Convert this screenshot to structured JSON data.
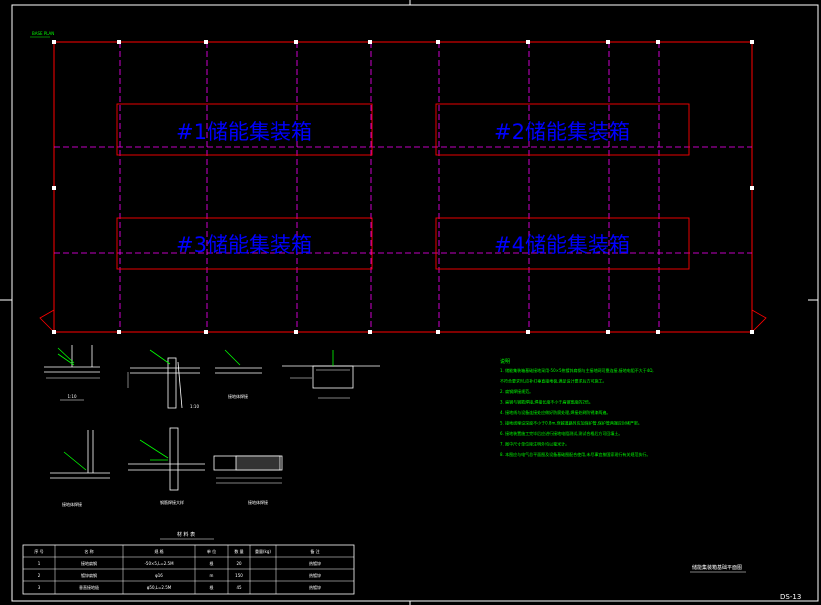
{
  "drawing": {
    "corner_label": "BASE PLAN",
    "sheet_number": "DS-13",
    "caption": "储能集装箱基础平面图"
  },
  "containers": [
    {
      "label": "#1储能集装箱"
    },
    {
      "label": "#2储能集装箱"
    },
    {
      "label": "#3储能集装箱"
    },
    {
      "label": "#4储能集装箱"
    }
  ],
  "notes": {
    "title": "说明",
    "lines": [
      "1. 储能集装箱基础接地采用-50×5热镀锌扁钢与主接地网可靠连接,接地电阻不大于4Ω,",
      "   不符合要求时,应补打垂直接地极,满足设计要求后方可施工。",
      "2. 扁钢焊接规范。",
      "3. 扁钢与钢筋焊接,焊接长度不小于扁钢宽度的2倍。",
      "4. 接地线与设备连接处应做好防腐处理,焊接处刷防锈漆两遍。",
      "5. 接地线埋设深度不小于0.8m,穿越道路时应加保护管,保护管两端应封堵严密。",
      "6. 接地装置施工完毕后应进行接地电阻测试,测试合格后方可回填土。",
      "7. 图中尺寸单位除注明外均以毫米计。",
      "8. 本图应与电气总平面图及设备基础图配合使用,未尽事宜按国家现行有关规范执行。"
    ]
  },
  "details": {
    "d1_label": "1:10",
    "d2_label": "1:10",
    "d3_label": "接地体焊接",
    "d5_label": "接地体焊接",
    "d6_label": "钢筋焊接大样",
    "d7_label": "接地体焊接"
  },
  "table": {
    "title": "材 料 表",
    "headers": [
      "序 号",
      "名 称",
      "规 格",
      "单 位",
      "数 量",
      "重量(kg)",
      "备 注"
    ],
    "rows": [
      [
        "1",
        "接地扁钢",
        "-50×5,L=2.5M",
        "根",
        "20",
        "",
        "热镀锌"
      ],
      [
        "2",
        "镀锌扁钢",
        "φ16",
        "m",
        "150",
        "",
        "热镀锌"
      ],
      [
        "3",
        "垂直接地极",
        "φ50,L=2.5M",
        "根",
        "45",
        "",
        "热镀锌"
      ]
    ]
  },
  "colors": {
    "background": "#000000",
    "outline": "#ff0000",
    "grid": "#ff00ff",
    "container_text": "#0000ff",
    "notes": "#00ff00",
    "frame": "#ffffff"
  }
}
